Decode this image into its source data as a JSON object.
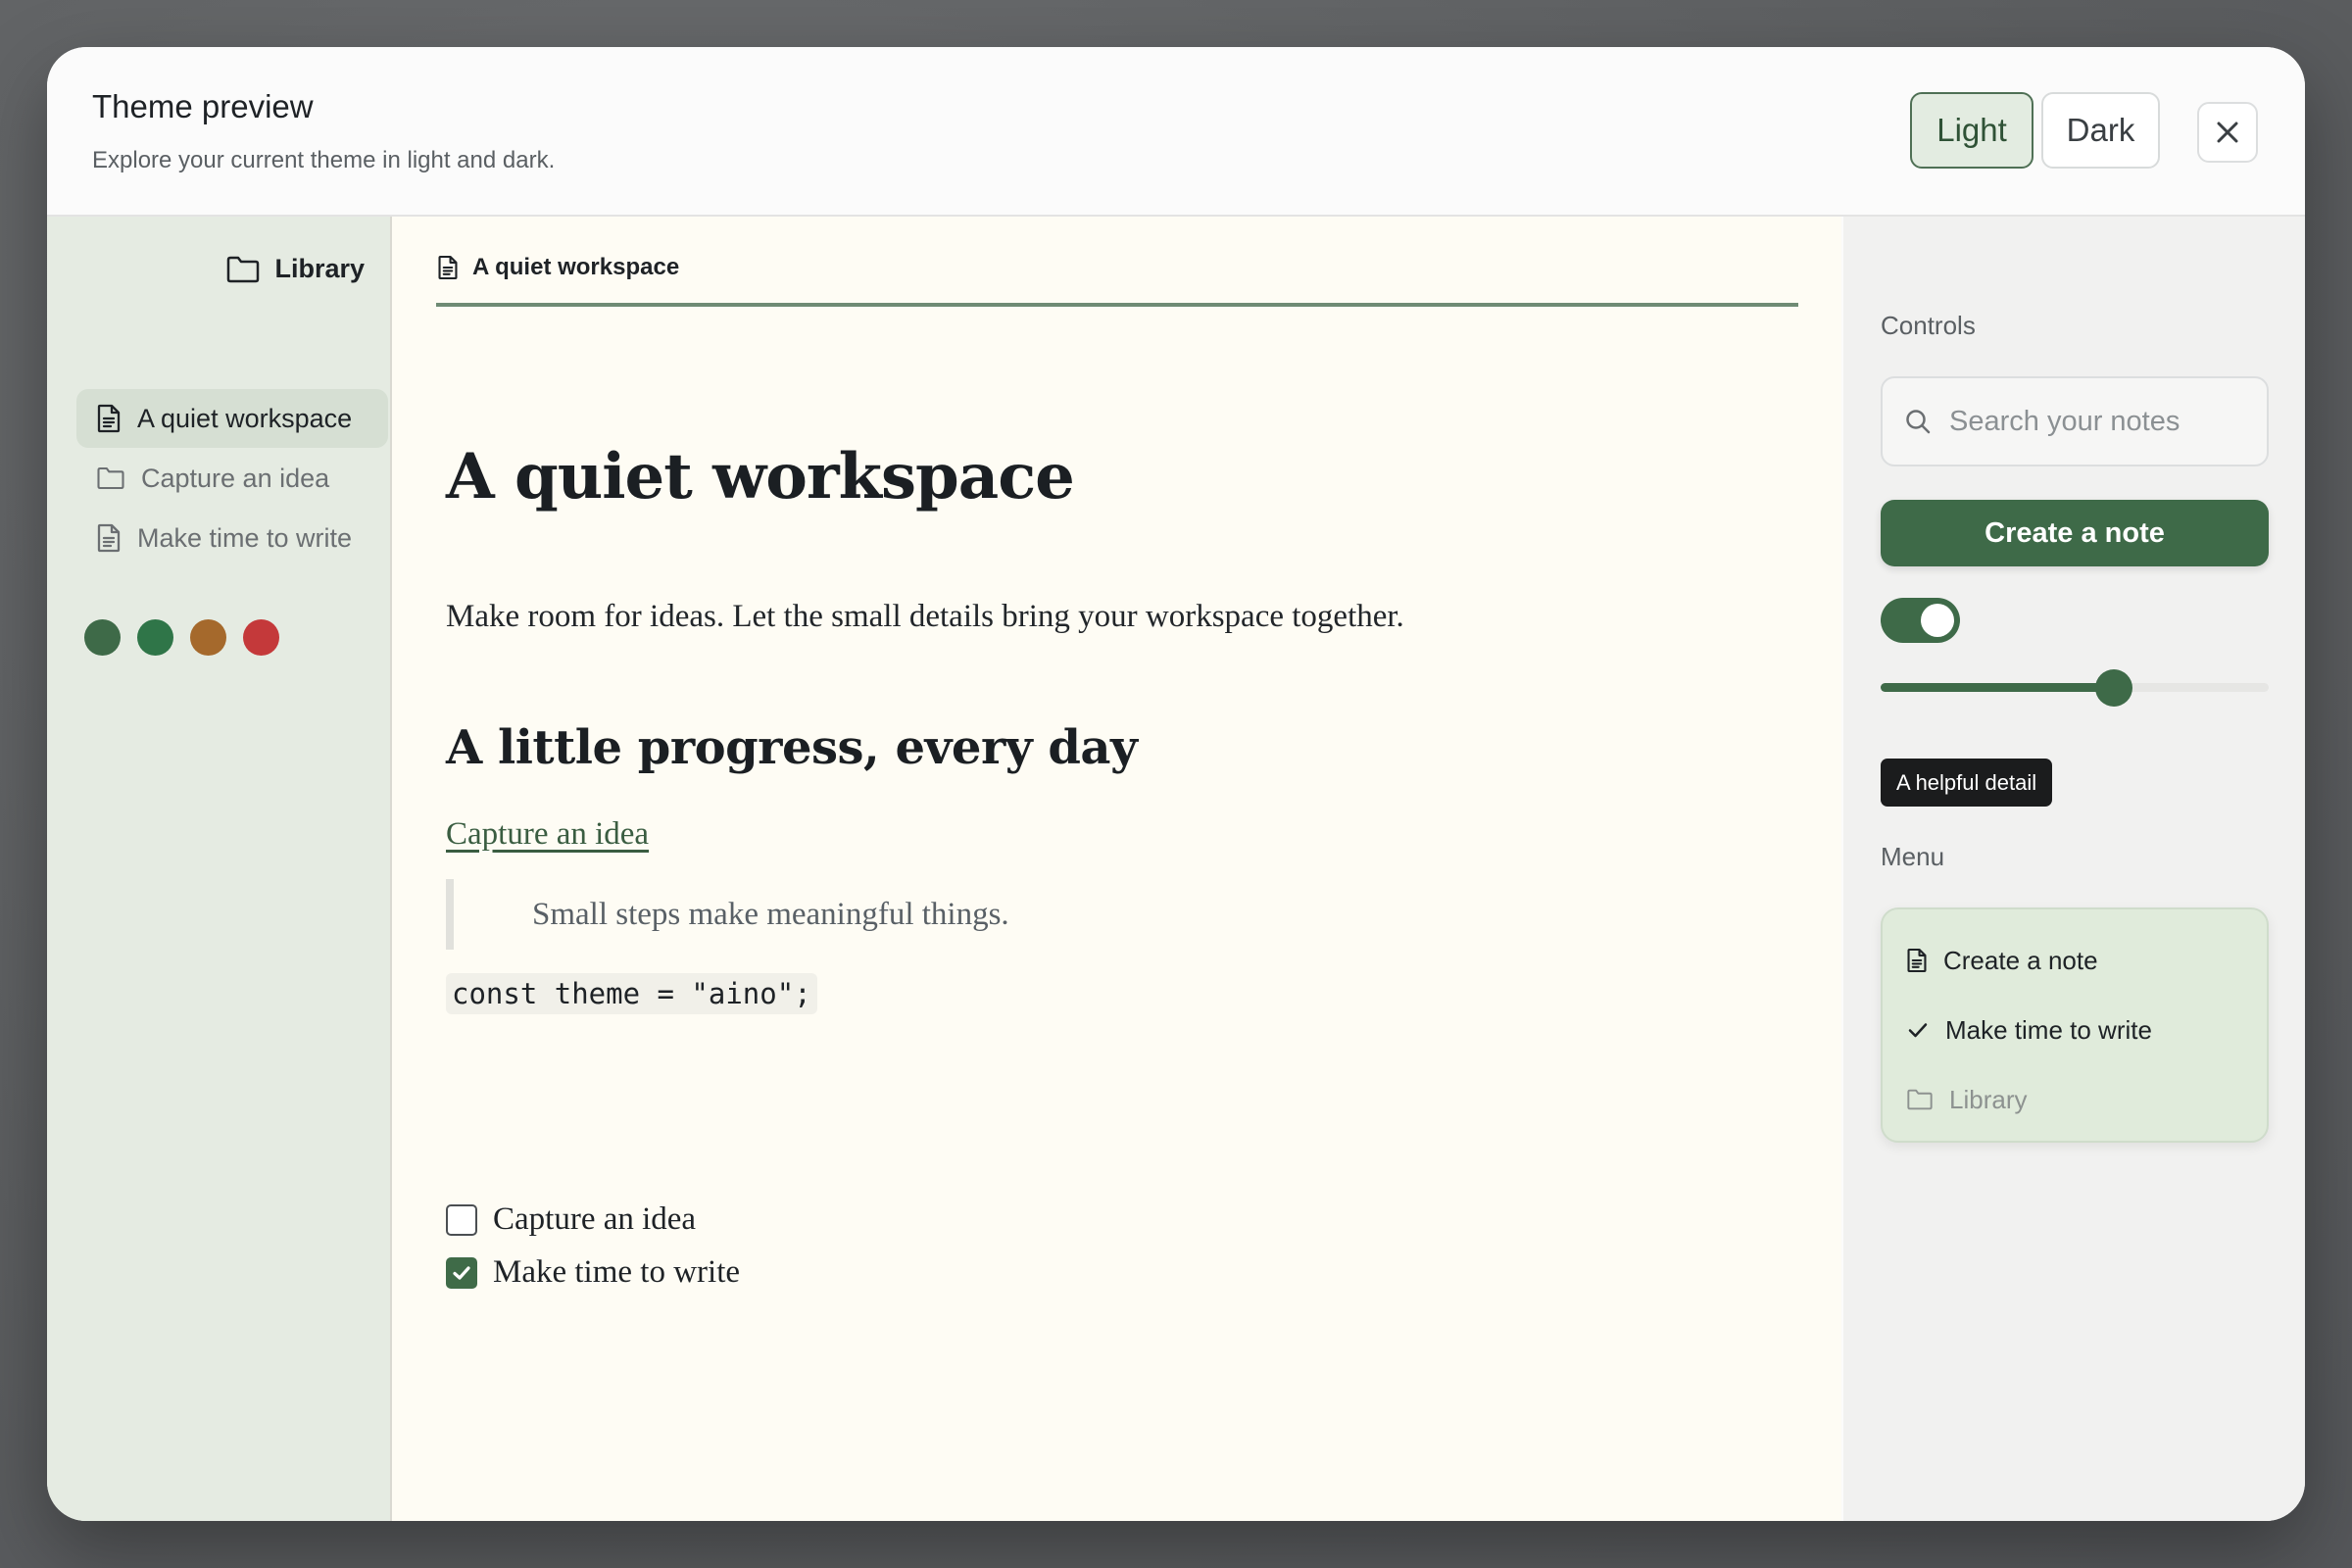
{
  "dialog": {
    "title": "Theme preview",
    "subtitle": "Explore your current theme in light and dark.",
    "modes": [
      {
        "label": "Light",
        "selected": true
      },
      {
        "label": "Dark",
        "selected": false
      }
    ],
    "close_icon": "close-icon"
  },
  "sidebar": {
    "header_label": "Library",
    "header_icon": "folder-icon",
    "items": [
      {
        "label": "A quiet workspace",
        "icon": "document-icon",
        "active": true
      },
      {
        "label": "Capture an idea",
        "icon": "folder-icon",
        "active": false
      },
      {
        "label": "Make time to write",
        "icon": "document-icon",
        "active": false
      }
    ],
    "swatches": [
      "#3e6a48",
      "#2f7548",
      "#a5692c",
      "#c4393a"
    ]
  },
  "main": {
    "tab_label": "A quiet workspace",
    "heading": "A quiet workspace",
    "lead": "Make room for ideas. Let the small details bring your workspace together.",
    "subheading": "A little progress, every day",
    "link": "Capture an idea",
    "quote": "Small steps make meaningful things.",
    "code": "const theme = \"aino\";",
    "checklist": [
      {
        "label": "Capture an idea",
        "checked": false
      },
      {
        "label": "Make time to write",
        "checked": true
      }
    ]
  },
  "controls": {
    "label": "Controls",
    "search_placeholder": "Search your notes",
    "primary_button": "Create a note",
    "toggle_on": true,
    "slider_value": 0.6,
    "tooltip": "A helpful detail",
    "menu_label": "Menu",
    "menu_items": [
      {
        "label": "Create a note",
        "icon": "document-icon",
        "disabled": false
      },
      {
        "label": "Make time to write",
        "icon": "check-icon",
        "disabled": false
      },
      {
        "label": "Library",
        "icon": "folder-icon",
        "disabled": true
      }
    ]
  },
  "colors": {
    "accent": "#3e6a48",
    "sidebar_bg": "#e5ebe2",
    "content_bg": "#fefcf4"
  }
}
